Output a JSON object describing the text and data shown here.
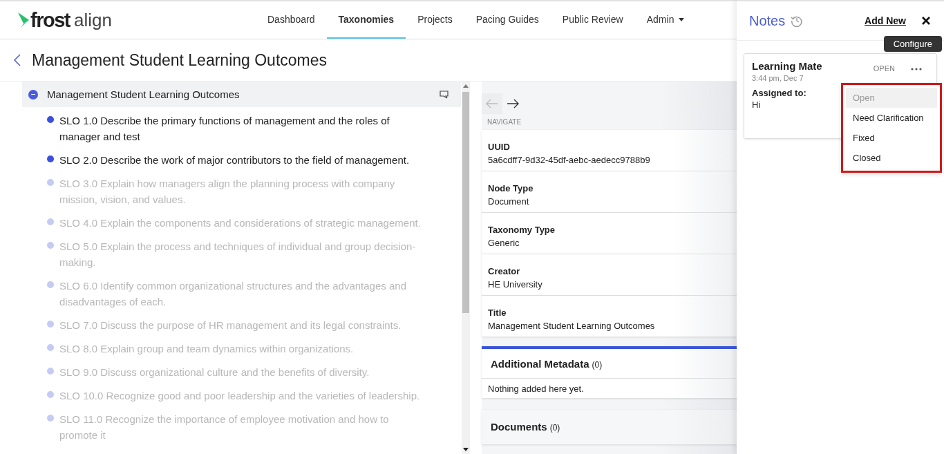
{
  "app": {
    "logo_bold": "frost",
    "logo_light": "align"
  },
  "nav": [
    {
      "label": "Dashboard",
      "selected": false,
      "dropdown": false
    },
    {
      "label": "Taxonomies",
      "selected": true,
      "dropdown": false
    },
    {
      "label": "Projects",
      "selected": false,
      "dropdown": false
    },
    {
      "label": "Pacing Guides",
      "selected": false,
      "dropdown": false
    },
    {
      "label": "Public Review",
      "selected": false,
      "dropdown": false
    },
    {
      "label": "Admin",
      "selected": false,
      "dropdown": true
    }
  ],
  "page": {
    "title": "Management Student Learning Outcomes"
  },
  "tree": {
    "label": "Management Student Learning Outcomes",
    "expanded": true,
    "children": [
      {
        "label": "SLO 1.0 Describe the primary functions of management and the roles of manager and test",
        "dimmed": false
      },
      {
        "label": "SLO 2.0 Describe the work of major contributors to the field of management.",
        "dimmed": false
      },
      {
        "label": "SLO 3.0 Explain how managers align the planning process with company mission, vision, and values.",
        "dimmed": true
      },
      {
        "label": "SLO 4.0 Explain the components and considerations of strategic management.",
        "dimmed": true
      },
      {
        "label": "SLO 5.0 Explain the process and techniques of individual and group decision-making.",
        "dimmed": true
      },
      {
        "label": "SLO 6.0 Identify common organizational structures and the advantages and disadvantages of each.",
        "dimmed": true
      },
      {
        "label": "SLO 7.0 Discuss the purpose of HR management and its legal constraints.",
        "dimmed": true
      },
      {
        "label": "SLO 8.0 Explain group and team dynamics within organizations.",
        "dimmed": true
      },
      {
        "label": "SLO 9.0 Discuss organizational culture and the benefits of diversity.",
        "dimmed": true
      },
      {
        "label": "SLO 10.0 Recognize good and poor leadership and the varieties of leadership.",
        "dimmed": true
      },
      {
        "label": "SLO 11.0 Recognize the importance of employee motivation and how to promote it",
        "dimmed": true
      }
    ]
  },
  "navigate": {
    "label": "NAVIGATE",
    "back_disabled": true,
    "forward_disabled": false
  },
  "details": [
    {
      "label": "UUID",
      "value": "5a6cdff7-9d32-45df-aebc-aedecc9788b9"
    },
    {
      "label": "Node Type",
      "value": "Document"
    },
    {
      "label": "Taxonomy Type",
      "value": "Generic"
    },
    {
      "label": "Creator",
      "value": "HE University"
    },
    {
      "label": "Title",
      "value": "Management Student Learning Outcomes"
    }
  ],
  "metadata": {
    "title": "Additional Metadata",
    "count": "(0)",
    "empty_text": "Nothing added here yet."
  },
  "documents": {
    "title": "Documents",
    "count": "(0)"
  },
  "notes": {
    "title": "Notes",
    "add_new": "Add New",
    "tooltip": "Configure",
    "cards": [
      {
        "author": "Learning Mate",
        "time": "3:44 pm, Dec 7",
        "status": "OPEN",
        "assigned_label": "Assigned to:",
        "assigned_value": "Hi",
        "menu_open": true,
        "menu": [
          {
            "label": "Open",
            "selected": true
          },
          {
            "label": "Need Clarification",
            "selected": false
          },
          {
            "label": "Fixed",
            "selected": false
          },
          {
            "label": "Closed",
            "selected": false
          }
        ]
      }
    ]
  }
}
